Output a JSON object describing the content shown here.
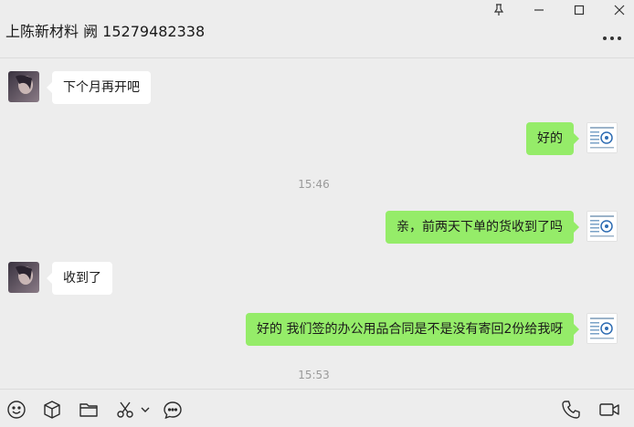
{
  "window": {
    "title": "上陈新材料 阙 15279482338"
  },
  "messages": [
    {
      "direction": "in",
      "text": "下个月再开吧"
    },
    {
      "direction": "out",
      "text": "好的"
    },
    {
      "type": "time",
      "text": "15:46"
    },
    {
      "direction": "out",
      "text": "亲，前两天下单的货收到了吗"
    },
    {
      "direction": "in",
      "text": "收到了"
    },
    {
      "direction": "out",
      "text": "好的 我们签的办公用品合同是不是没有寄回2份给我呀"
    },
    {
      "type": "time",
      "text": "15:53"
    }
  ],
  "toolbar": {
    "left_icons": [
      "emoji-icon",
      "cube-icon",
      "folder-icon",
      "scissors-icon",
      "chevron-down-icon",
      "chat-bubble-icon"
    ],
    "right_icons": [
      "phone-icon",
      "video-icon"
    ]
  },
  "colors": {
    "background": "#ededed",
    "outgoing_bubble": "#95ec69",
    "incoming_bubble": "#ffffff",
    "timestamp": "#9a9a9a"
  }
}
